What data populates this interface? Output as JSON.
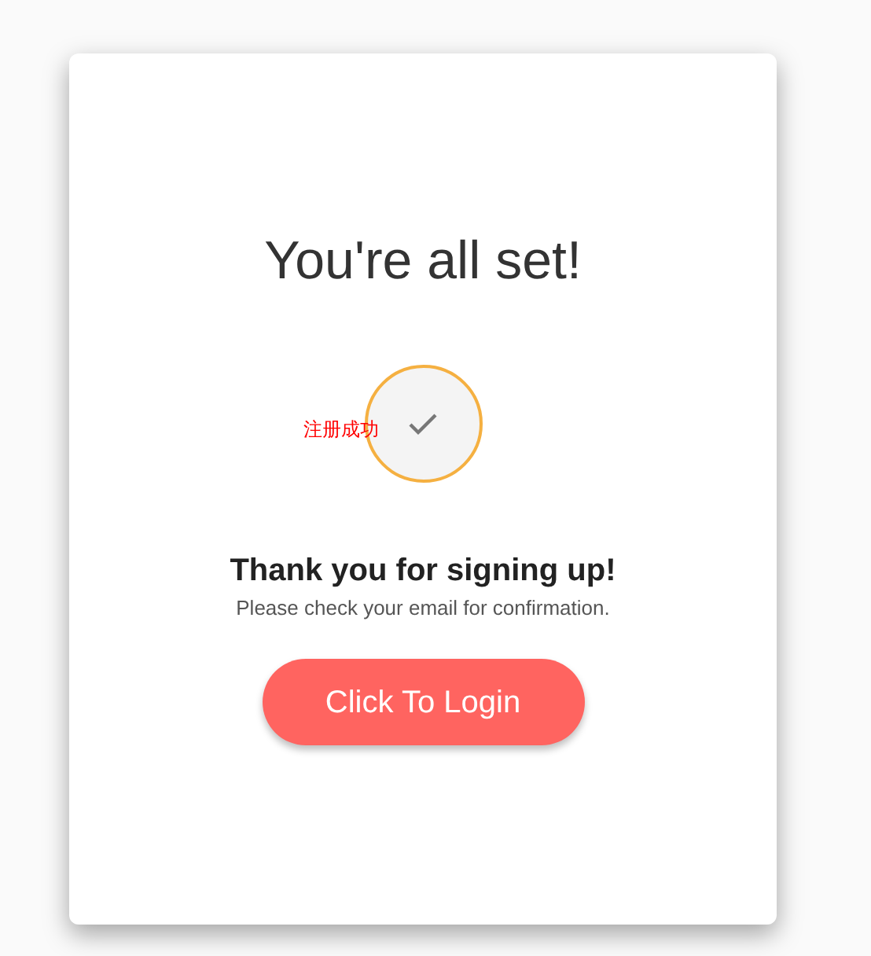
{
  "title": "You're all set!",
  "status_label": "注册成功",
  "heading": "Thank you for signing up!",
  "message": "Please check your email for confirmation.",
  "button": "Click To Login"
}
